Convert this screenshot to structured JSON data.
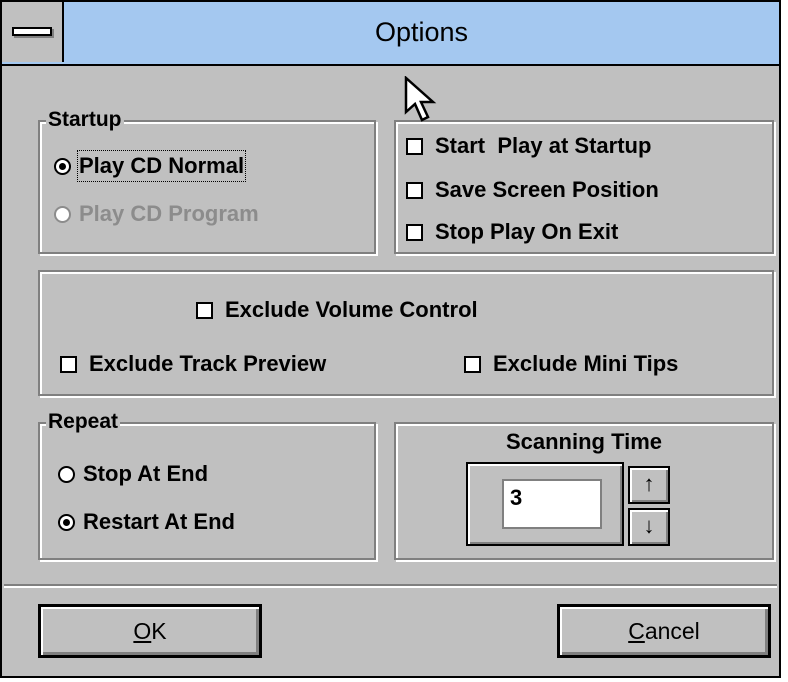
{
  "window": {
    "title": "Options"
  },
  "startup": {
    "legend": "Startup",
    "options": [
      {
        "label": "Play CD Normal",
        "checked": true,
        "enabled": true
      },
      {
        "label": "Play CD Program",
        "checked": false,
        "enabled": false
      }
    ]
  },
  "startup_checks": [
    {
      "label": "Start  Play at Startup",
      "checked": false
    },
    {
      "label": "Save Screen Position",
      "checked": false
    },
    {
      "label": "Stop Play On Exit",
      "checked": false
    }
  ],
  "exclude": {
    "volume": {
      "label": "Exclude Volume Control",
      "checked": false
    },
    "track_preview": {
      "label": "Exclude Track Preview",
      "checked": false
    },
    "mini_tips": {
      "label": "Exclude Mini Tips",
      "checked": false
    }
  },
  "repeat": {
    "legend": "Repeat",
    "options": [
      {
        "label": "Stop At End",
        "checked": false
      },
      {
        "label": "Restart At End",
        "checked": true
      }
    ]
  },
  "scanning": {
    "label": "Scanning Time",
    "value": "3",
    "up_icon": "↑",
    "down_icon": "↓"
  },
  "buttons": {
    "ok_mnemonic": "O",
    "ok_rest": "K",
    "cancel_mnemonic": "C",
    "cancel_rest": "ancel"
  },
  "colors": {
    "face": "#c0c0c0",
    "title_bar": "#a4c8f0",
    "disabled_text": "#8c8c8c"
  }
}
